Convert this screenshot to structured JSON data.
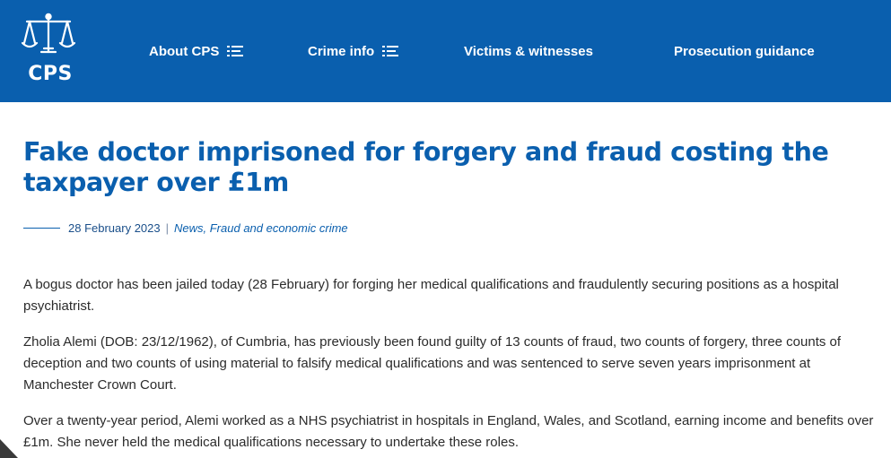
{
  "header": {
    "logo_text": "CPS",
    "nav": [
      {
        "label": "About CPS",
        "has_menu": true
      },
      {
        "label": "Crime info",
        "has_menu": true
      },
      {
        "label": "Victims & witnesses",
        "has_menu": false
      },
      {
        "label": "Prosecution guidance",
        "has_menu": false
      }
    ]
  },
  "article": {
    "title": "Fake doctor imprisoned for forgery and fraud costing the taxpayer over £1m",
    "date": "28 February 2023",
    "separator": "|",
    "categories": "News, Fraud and economic crime",
    "paragraphs": [
      "A bogus doctor has been jailed today (28 February) for forging her medical qualifications and fraudulently securing positions as a hospital psychiatrist.",
      "Zholia Alemi (DOB: 23/12/1962), of Cumbria, has previously been found guilty of 13 counts of fraud, two counts of forgery, three counts of deception and two counts of using material to falsify medical qualifications and was sentenced to serve seven years imprisonment at Manchester Crown Court.",
      "Over a twenty-year period, Alemi worked as a NHS psychiatrist in hospitals in England, Wales, and Scotland, earning income and benefits over £1m. She never held the medical qualifications necessary to undertake these roles."
    ]
  },
  "colors": {
    "brand_blue": "#0a5fae",
    "text": "#2b2b2b",
    "header_text": "#ffffff"
  },
  "icons": {
    "logo": "scales-of-justice-icon",
    "menu": "menu-lines-icon"
  }
}
